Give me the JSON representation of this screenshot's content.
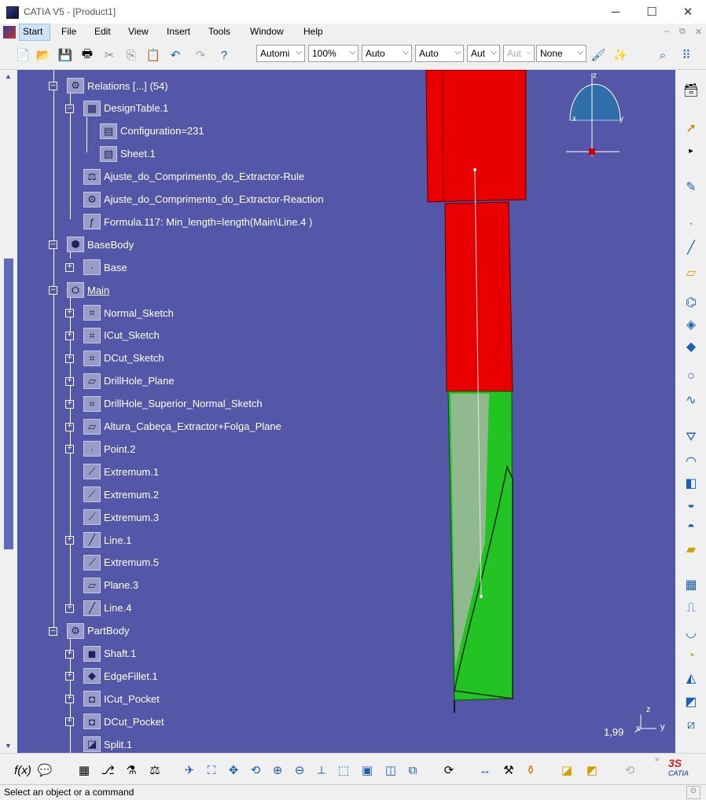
{
  "window": {
    "title": "CATIA V5 - [Product1]",
    "minimize": "─",
    "maximize": "☐",
    "close": "✕"
  },
  "menubar": {
    "items": [
      "Start",
      "File",
      "Edit",
      "View",
      "Insert",
      "Tools",
      "Window",
      "Help"
    ]
  },
  "toolbar": {
    "combos": [
      {
        "value": "Automi"
      },
      {
        "value": "100%"
      },
      {
        "value": "Auto"
      },
      {
        "value": "Auto"
      },
      {
        "value": "Aut"
      },
      {
        "value": "Aut",
        "disabled": true
      },
      {
        "value": "None"
      }
    ]
  },
  "tree": [
    {
      "label": "Relations [...] (54)",
      "icon": "relations-icon"
    },
    {
      "label": "DesignTable.1",
      "icon": "design-table-icon"
    },
    {
      "label": "Configuration=231",
      "icon": "configuration-icon"
    },
    {
      "label": "Sheet.1",
      "icon": "sheet-icon"
    },
    {
      "label": "Ajuste_do_Comprimento_do_Extractor-Rule",
      "icon": "rule-icon"
    },
    {
      "label": "Ajuste_do_Comprimento_do_Extractor-Reaction",
      "icon": "reaction-icon"
    },
    {
      "label": "Formula.117: Min_length=length(Main\\Line.4 )",
      "icon": "formula-icon"
    },
    {
      "label": "BaseBody",
      "icon": "body-icon"
    },
    {
      "label": "Base",
      "icon": "point-icon"
    },
    {
      "label": "Main",
      "icon": "geometrical-set-icon"
    },
    {
      "label": "Normal_Sketch",
      "icon": "sketch-icon"
    },
    {
      "label": "ICut_Sketch",
      "icon": "sketch-icon"
    },
    {
      "label": "DCut_Sketch",
      "icon": "sketch-icon"
    },
    {
      "label": "DrillHole_Plane",
      "icon": "plane-icon"
    },
    {
      "label": "DrillHole_Superior_Normal_Sketch",
      "icon": "sketch-icon"
    },
    {
      "label": "Altura_Cabeça_Extractor+Folga_Plane",
      "icon": "plane-icon"
    },
    {
      "label": "Point.2",
      "icon": "point-icon"
    },
    {
      "label": "Extremum.1",
      "icon": "extremum-icon"
    },
    {
      "label": "Extremum.2",
      "icon": "extremum-icon"
    },
    {
      "label": "Extremum.3",
      "icon": "extremum-icon"
    },
    {
      "label": "Line.1",
      "icon": "line-icon"
    },
    {
      "label": "Extremum.5",
      "icon": "extremum-icon"
    },
    {
      "label": "Plane.3",
      "icon": "plane-icon"
    },
    {
      "label": "Line.4",
      "icon": "line-icon"
    },
    {
      "label": "PartBody",
      "icon": "part-body-icon"
    },
    {
      "label": "Shaft.1",
      "icon": "shaft-icon"
    },
    {
      "label": "EdgeFillet.1",
      "icon": "edge-fillet-icon"
    },
    {
      "label": "ICut_Pocket",
      "icon": "pocket-icon"
    },
    {
      "label": "DCut_Pocket",
      "icon": "pocket-icon"
    },
    {
      "label": "Split.1",
      "icon": "split-icon"
    }
  ],
  "viewport": {
    "background": "#5457a8",
    "zoom_value": "1,99",
    "compass": {
      "z": "z",
      "x": "x",
      "y": "y"
    },
    "axis": {
      "z": "z",
      "x": "x",
      "y": "y"
    },
    "part_colors": {
      "upper": "#e80000",
      "lower": "#22c322"
    }
  },
  "statusbar": {
    "text": "Select an object or a command"
  },
  "brand": {
    "logo_text": "CATIA"
  }
}
